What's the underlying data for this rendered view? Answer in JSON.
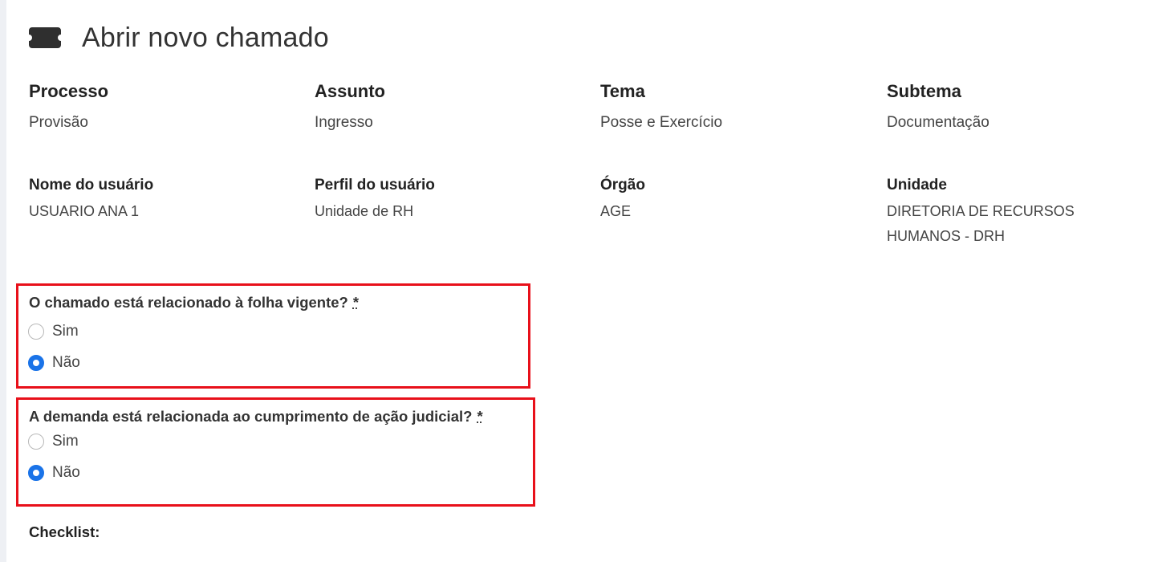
{
  "page": {
    "title": "Abrir novo chamado"
  },
  "summary_top": [
    {
      "label": "Processo",
      "value": "Provisão"
    },
    {
      "label": "Assunto",
      "value": "Ingresso"
    },
    {
      "label": "Tema",
      "value": "Posse e Exercício"
    },
    {
      "label": "Subtema",
      "value": "Documentação"
    }
  ],
  "summary_bottom": [
    {
      "label": "Nome do usuário",
      "value": "USUARIO ANA 1"
    },
    {
      "label": "Perfil do usuário",
      "value": "Unidade de RH"
    },
    {
      "label": "Órgão",
      "value": "AGE"
    },
    {
      "label": "Unidade",
      "value": "DIRETORIA DE RECURSOS HUMANOS - DRH"
    }
  ],
  "questions": [
    {
      "text": "O chamado está relacionado à folha vigente?",
      "required_mark": "*",
      "options": [
        {
          "label": "Sim",
          "selected": false
        },
        {
          "label": "Não",
          "selected": true
        }
      ]
    },
    {
      "text": "A demanda está relacionada ao cumprimento de ação judicial?",
      "required_mark": "*",
      "options": [
        {
          "label": "Sim",
          "selected": false
        },
        {
          "label": "Não",
          "selected": true
        }
      ]
    }
  ],
  "checklist": {
    "label": "Checklist:"
  },
  "colors": {
    "highlight_border": "#e8101a",
    "radio_selected": "#1a73e8"
  },
  "icons": {
    "title_icon": "ticket-icon"
  }
}
